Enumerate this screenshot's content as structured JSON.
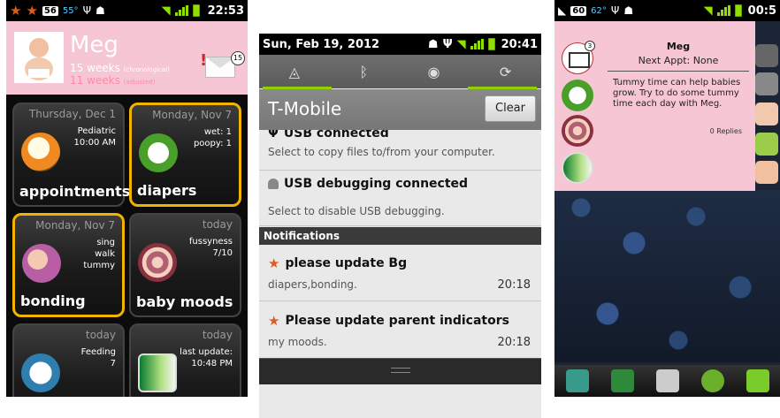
{
  "screen1": {
    "status": {
      "badge": "56",
      "temp": "55°",
      "time": "22:53"
    },
    "baby": {
      "name": "Meg",
      "weeks": "15 weeks",
      "weeks_note": "(chronological)",
      "adjusted": "11 weeks",
      "adjusted_note": "(adjusted)",
      "mail_count": "15",
      "alert": "!"
    },
    "tiles": [
      {
        "date": "Thursday, Dec 1",
        "info": "Pediatric\n10:00 AM",
        "label": "appointments"
      },
      {
        "date": "Monday, Nov 7",
        "info": "wet: 1\npoopy: 1",
        "label": "diapers"
      },
      {
        "date": "Monday, Nov 7",
        "info": "sing\nwalk\ntummy",
        "label": "bonding"
      },
      {
        "date": "today",
        "info": "fussyness\n7/10",
        "label": "baby moods"
      },
      {
        "date": "today",
        "info": "Feeding\n7",
        "label": ""
      },
      {
        "date": "today",
        "info": "last update:\n10:48 PM",
        "label": ""
      }
    ]
  },
  "screen2": {
    "status": {
      "date": "Sun, Feb 19, 2012",
      "time": "20:41"
    },
    "carrier": "T-Mobile",
    "clear_label": "Clear",
    "ongoing": [
      {
        "title": "USB connected",
        "sub": "Select to copy files to/from your computer."
      },
      {
        "title": "USB debugging connected",
        "sub": "Select to disable USB debugging."
      }
    ],
    "section_label": "Notifications",
    "notifications": [
      {
        "title": "please update Bg",
        "sub": "diapers,bonding.",
        "time": "20:18"
      },
      {
        "title": "Please update parent indicators",
        "sub": "my moods.",
        "time": "20:18"
      }
    ]
  },
  "screen3": {
    "status": {
      "badge": "60",
      "temp": "62°",
      "time": "00:5"
    },
    "widget": {
      "name": "Meg",
      "appt": "Next Appt: None",
      "message": "Tummy time can help babies grow. Try to do some tummy time each day with Meg.",
      "replies": "0 Replies",
      "mail_count": "3",
      "page_dots": "• • • •"
    }
  }
}
